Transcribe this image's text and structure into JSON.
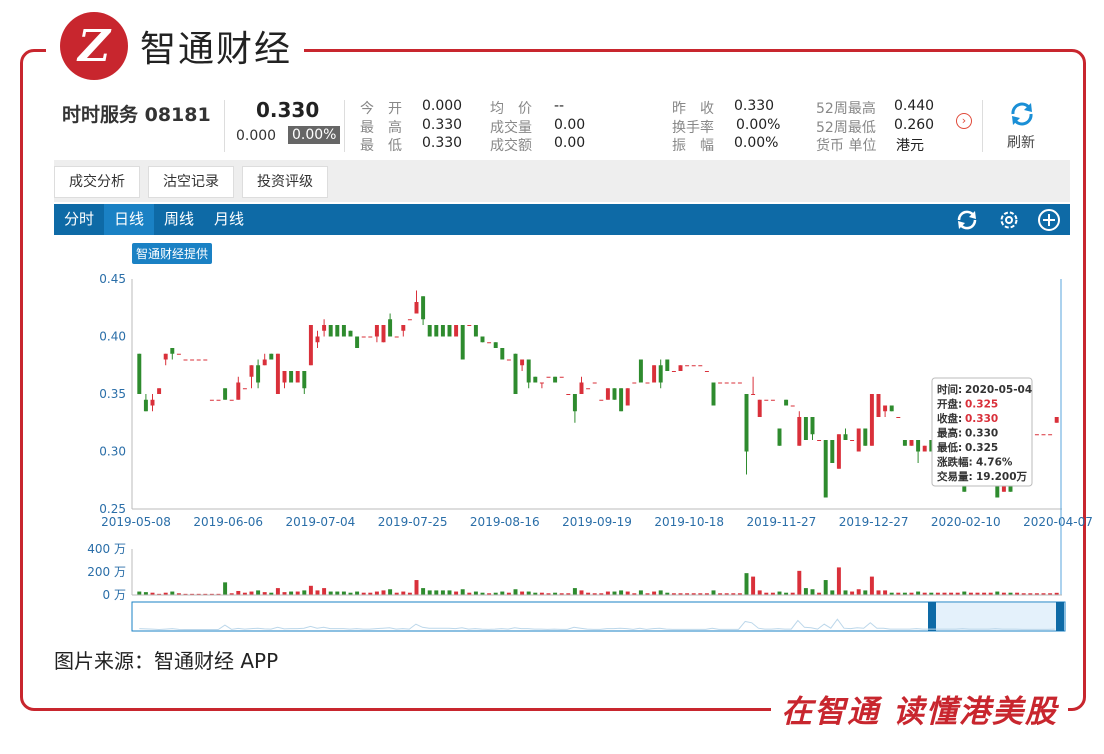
{
  "brand": {
    "logo_letter": "Z",
    "name": "智通财经",
    "slogan": "在智通  读懂港美股"
  },
  "stock": {
    "name_code": "时时服务 08181",
    "price": "0.330",
    "change": "0.000",
    "change_pct": "0.00%"
  },
  "quotes": [
    {
      "label": "今　开",
      "value": "0.000"
    },
    {
      "label": "最　高",
      "value": "0.330"
    },
    {
      "label": "最　低",
      "value": "0.330"
    },
    {
      "label": "均　价",
      "value": "--"
    },
    {
      "label": "成交量",
      "value": "0.00"
    },
    {
      "label": "成交额",
      "value": "0.00"
    },
    {
      "label": "昨　收",
      "value": "0.330"
    },
    {
      "label": "换手率",
      "value": "0.00%"
    },
    {
      "label": "振　幅",
      "value": "0.00%"
    },
    {
      "label": "52周最高",
      "value": "0.440"
    },
    {
      "label": "52周最低",
      "value": "0.260"
    },
    {
      "label": "货币 单位",
      "value": "港元"
    }
  ],
  "refresh_label": "刷新",
  "tabs": [
    "成交分析",
    "沽空记录",
    "投资评级"
  ],
  "period_tabs": [
    "分时",
    "日线",
    "周线",
    "月线"
  ],
  "active_period": "日线",
  "provided_by": "智通财经提供",
  "caption": "图片来源：智通财经 APP",
  "colors": {
    "up": "#d9303a",
    "down": "#2e8b2e",
    "brand": "#c8262e",
    "toolbar": "#0e6aa6"
  },
  "tooltip": {
    "time": {
      "label": "时间",
      "value": "2020-05-04"
    },
    "open": {
      "label": "开盘",
      "value": "0.325"
    },
    "close": {
      "label": "收盘",
      "value": "0.330"
    },
    "high": {
      "label": "最高",
      "value": "0.330"
    },
    "low": {
      "label": "最低",
      "value": "0.325"
    },
    "change": {
      "label": "涨跌幅",
      "value": "4.76%"
    },
    "volume": {
      "label": "交易量",
      "value": "19.200万"
    }
  },
  "chart_data": {
    "type": "candlestick",
    "ylim": [
      0.25,
      0.45
    ],
    "y_ticks": [
      "0.45",
      "0.40",
      "0.35",
      "0.30",
      "0.25"
    ],
    "x_ticks": [
      "2019-05-08",
      "2019-06-06",
      "2019-07-04",
      "2019-07-25",
      "2019-08-16",
      "2019-09-19",
      "2019-10-18",
      "2019-11-27",
      "2019-12-27",
      "2020-02-10",
      "2020-04-07"
    ],
    "volume_ticks": [
      "400 万",
      "200 万",
      "0 万"
    ],
    "volume_ylim": [
      0,
      400
    ],
    "candles": [
      [
        0.385,
        0.35,
        0.385,
        0.35,
        30
      ],
      [
        0.345,
        0.335,
        0.35,
        0.335,
        25
      ],
      [
        0.34,
        0.345,
        0.35,
        0.335,
        20
      ],
      [
        0.35,
        0.355,
        0.355,
        0.35,
        10
      ],
      [
        0.38,
        0.385,
        0.385,
        0.375,
        20
      ],
      [
        0.39,
        0.385,
        0.39,
        0.38,
        30
      ],
      [
        0.385,
        0.385,
        0.385,
        0.385,
        15
      ],
      [
        0.38,
        0.38,
        0.38,
        0.38,
        10
      ],
      [
        0.38,
        0.38,
        0.38,
        0.38,
        10
      ],
      [
        0.38,
        0.38,
        0.38,
        0.38,
        10
      ],
      [
        0.38,
        0.38,
        0.38,
        0.38,
        10
      ],
      [
        0.345,
        0.345,
        0.345,
        0.345,
        10
      ],
      [
        0.345,
        0.345,
        0.345,
        0.345,
        10
      ],
      [
        0.355,
        0.345,
        0.355,
        0.345,
        110
      ],
      [
        0.345,
        0.345,
        0.345,
        0.345,
        15
      ],
      [
        0.345,
        0.36,
        0.365,
        0.345,
        35
      ],
      [
        0.355,
        0.355,
        0.355,
        0.355,
        20
      ],
      [
        0.365,
        0.375,
        0.375,
        0.355,
        30
      ],
      [
        0.375,
        0.36,
        0.38,
        0.355,
        40
      ],
      [
        0.375,
        0.38,
        0.385,
        0.375,
        25
      ],
      [
        0.385,
        0.38,
        0.385,
        0.38,
        20
      ],
      [
        0.35,
        0.385,
        0.385,
        0.35,
        60
      ],
      [
        0.36,
        0.37,
        0.37,
        0.355,
        25
      ],
      [
        0.37,
        0.36,
        0.37,
        0.36,
        30
      ],
      [
        0.36,
        0.37,
        0.37,
        0.36,
        30
      ],
      [
        0.37,
        0.355,
        0.37,
        0.35,
        40
      ],
      [
        0.375,
        0.41,
        0.41,
        0.375,
        80
      ],
      [
        0.395,
        0.4,
        0.405,
        0.39,
        40
      ],
      [
        0.405,
        0.41,
        0.415,
        0.4,
        60
      ],
      [
        0.41,
        0.4,
        0.41,
        0.4,
        30
      ],
      [
        0.41,
        0.4,
        0.41,
        0.4,
        30
      ],
      [
        0.41,
        0.4,
        0.41,
        0.4,
        30
      ],
      [
        0.405,
        0.4,
        0.405,
        0.4,
        20
      ],
      [
        0.4,
        0.39,
        0.4,
        0.39,
        30
      ],
      [
        0.4,
        0.4,
        0.4,
        0.4,
        20
      ],
      [
        0.4,
        0.4,
        0.4,
        0.4,
        20
      ],
      [
        0.4,
        0.41,
        0.41,
        0.395,
        30
      ],
      [
        0.395,
        0.41,
        0.41,
        0.395,
        40
      ],
      [
        0.415,
        0.4,
        0.42,
        0.4,
        50
      ],
      [
        0.4,
        0.4,
        0.4,
        0.4,
        20
      ],
      [
        0.405,
        0.41,
        0.41,
        0.4,
        30
      ],
      [
        0.415,
        0.415,
        0.415,
        0.415,
        20
      ],
      [
        0.42,
        0.43,
        0.44,
        0.42,
        130
      ],
      [
        0.435,
        0.415,
        0.435,
        0.41,
        60
      ],
      [
        0.41,
        0.4,
        0.41,
        0.4,
        40
      ],
      [
        0.41,
        0.4,
        0.41,
        0.4,
        40
      ],
      [
        0.41,
        0.4,
        0.41,
        0.4,
        40
      ],
      [
        0.41,
        0.4,
        0.41,
        0.4,
        40
      ],
      [
        0.4,
        0.41,
        0.41,
        0.4,
        30
      ],
      [
        0.41,
        0.38,
        0.41,
        0.38,
        50
      ],
      [
        0.41,
        0.41,
        0.41,
        0.41,
        20
      ],
      [
        0.41,
        0.4,
        0.41,
        0.4,
        30
      ],
      [
        0.4,
        0.395,
        0.4,
        0.395,
        20
      ],
      [
        0.395,
        0.395,
        0.395,
        0.395,
        15
      ],
      [
        0.395,
        0.39,
        0.395,
        0.39,
        20
      ],
      [
        0.39,
        0.38,
        0.39,
        0.38,
        30
      ],
      [
        0.38,
        0.38,
        0.38,
        0.38,
        20
      ],
      [
        0.385,
        0.35,
        0.385,
        0.35,
        50
      ],
      [
        0.375,
        0.38,
        0.38,
        0.37,
        30
      ],
      [
        0.38,
        0.36,
        0.38,
        0.355,
        30
      ],
      [
        0.365,
        0.36,
        0.365,
        0.36,
        20
      ],
      [
        0.36,
        0.36,
        0.36,
        0.355,
        20
      ],
      [
        0.365,
        0.365,
        0.365,
        0.365,
        15
      ],
      [
        0.365,
        0.36,
        0.365,
        0.36,
        20
      ],
      [
        0.365,
        0.365,
        0.365,
        0.365,
        15
      ],
      [
        0.35,
        0.35,
        0.35,
        0.35,
        15
      ],
      [
        0.35,
        0.335,
        0.35,
        0.325,
        60
      ],
      [
        0.35,
        0.36,
        0.365,
        0.35,
        40
      ],
      [
        0.355,
        0.355,
        0.355,
        0.355,
        20
      ],
      [
        0.36,
        0.36,
        0.36,
        0.36,
        15
      ],
      [
        0.345,
        0.345,
        0.345,
        0.345,
        15
      ],
      [
        0.345,
        0.355,
        0.355,
        0.345,
        30
      ],
      [
        0.355,
        0.345,
        0.355,
        0.345,
        30
      ],
      [
        0.355,
        0.335,
        0.355,
        0.335,
        40
      ],
      [
        0.34,
        0.355,
        0.355,
        0.34,
        30
      ],
      [
        0.36,
        0.36,
        0.36,
        0.36,
        15
      ],
      [
        0.38,
        0.36,
        0.38,
        0.36,
        40
      ],
      [
        0.36,
        0.36,
        0.36,
        0.36,
        15
      ],
      [
        0.36,
        0.375,
        0.375,
        0.36,
        30
      ],
      [
        0.375,
        0.36,
        0.38,
        0.355,
        40
      ],
      [
        0.38,
        0.37,
        0.38,
        0.37,
        20
      ],
      [
        0.37,
        0.37,
        0.37,
        0.37,
        15
      ],
      [
        0.37,
        0.375,
        0.375,
        0.37,
        15
      ],
      [
        0.375,
        0.375,
        0.375,
        0.375,
        15
      ],
      [
        0.375,
        0.375,
        0.375,
        0.375,
        15
      ],
      [
        0.375,
        0.375,
        0.375,
        0.375,
        15
      ],
      [
        0.37,
        0.37,
        0.37,
        0.37,
        15
      ],
      [
        0.36,
        0.34,
        0.36,
        0.34,
        40
      ],
      [
        0.36,
        0.36,
        0.36,
        0.36,
        15
      ],
      [
        0.36,
        0.36,
        0.36,
        0.36,
        15
      ],
      [
        0.36,
        0.36,
        0.36,
        0.36,
        15
      ],
      [
        0.36,
        0.36,
        0.36,
        0.36,
        15
      ],
      [
        0.35,
        0.3,
        0.35,
        0.28,
        190
      ],
      [
        0.35,
        0.35,
        0.365,
        0.35,
        160
      ],
      [
        0.33,
        0.345,
        0.345,
        0.33,
        40
      ],
      [
        0.345,
        0.345,
        0.345,
        0.345,
        20
      ],
      [
        0.345,
        0.345,
        0.345,
        0.345,
        20
      ],
      [
        0.32,
        0.305,
        0.32,
        0.305,
        30
      ],
      [
        0.345,
        0.34,
        0.345,
        0.34,
        20
      ],
      [
        0.34,
        0.34,
        0.34,
        0.34,
        20
      ],
      [
        0.305,
        0.33,
        0.335,
        0.305,
        210
      ],
      [
        0.33,
        0.31,
        0.33,
        0.31,
        60
      ],
      [
        0.33,
        0.315,
        0.33,
        0.31,
        50
      ],
      [
        0.31,
        0.31,
        0.31,
        0.31,
        20
      ],
      [
        0.31,
        0.26,
        0.31,
        0.26,
        130
      ],
      [
        0.31,
        0.29,
        0.31,
        0.29,
        40
      ],
      [
        0.285,
        0.315,
        0.315,
        0.285,
        240
      ],
      [
        0.315,
        0.31,
        0.32,
        0.31,
        40
      ],
      [
        0.31,
        0.31,
        0.31,
        0.31,
        30
      ],
      [
        0.3,
        0.32,
        0.32,
        0.3,
        50
      ],
      [
        0.32,
        0.305,
        0.32,
        0.305,
        40
      ],
      [
        0.305,
        0.35,
        0.35,
        0.305,
        160
      ],
      [
        0.33,
        0.35,
        0.35,
        0.33,
        40
      ],
      [
        0.335,
        0.34,
        0.34,
        0.33,
        40
      ],
      [
        0.34,
        0.335,
        0.34,
        0.335,
        20
      ],
      [
        0.33,
        0.33,
        0.33,
        0.33,
        20
      ],
      [
        0.31,
        0.305,
        0.31,
        0.305,
        20
      ],
      [
        0.305,
        0.31,
        0.31,
        0.305,
        20
      ],
      [
        0.31,
        0.3,
        0.31,
        0.29,
        30
      ],
      [
        0.3,
        0.305,
        0.305,
        0.3,
        20
      ],
      [
        0.31,
        0.3,
        0.31,
        0.3,
        20
      ],
      [
        0.3,
        0.3,
        0.3,
        0.3,
        20
      ],
      [
        0.3,
        0.3,
        0.3,
        0.3,
        20
      ],
      [
        0.3,
        0.3,
        0.3,
        0.3,
        20
      ],
      [
        0.3,
        0.3,
        0.3,
        0.3,
        20
      ],
      [
        0.275,
        0.265,
        0.275,
        0.265,
        30
      ],
      [
        0.28,
        0.28,
        0.28,
        0.28,
        20
      ],
      [
        0.28,
        0.28,
        0.28,
        0.28,
        20
      ],
      [
        0.275,
        0.275,
        0.275,
        0.275,
        20
      ],
      [
        0.275,
        0.275,
        0.275,
        0.275,
        20
      ],
      [
        0.27,
        0.26,
        0.27,
        0.26,
        30
      ],
      [
        0.265,
        0.27,
        0.27,
        0.265,
        20
      ],
      [
        0.27,
        0.265,
        0.27,
        0.265,
        20
      ],
      [
        0.3,
        0.3,
        0.3,
        0.3,
        20
      ],
      [
        0.31,
        0.31,
        0.31,
        0.31,
        15
      ],
      [
        0.31,
        0.31,
        0.31,
        0.31,
        15
      ],
      [
        0.315,
        0.315,
        0.315,
        0.315,
        15
      ],
      [
        0.315,
        0.315,
        0.315,
        0.315,
        15
      ],
      [
        0.315,
        0.315,
        0.315,
        0.315,
        15
      ],
      [
        0.325,
        0.33,
        0.33,
        0.325,
        19
      ]
    ]
  }
}
